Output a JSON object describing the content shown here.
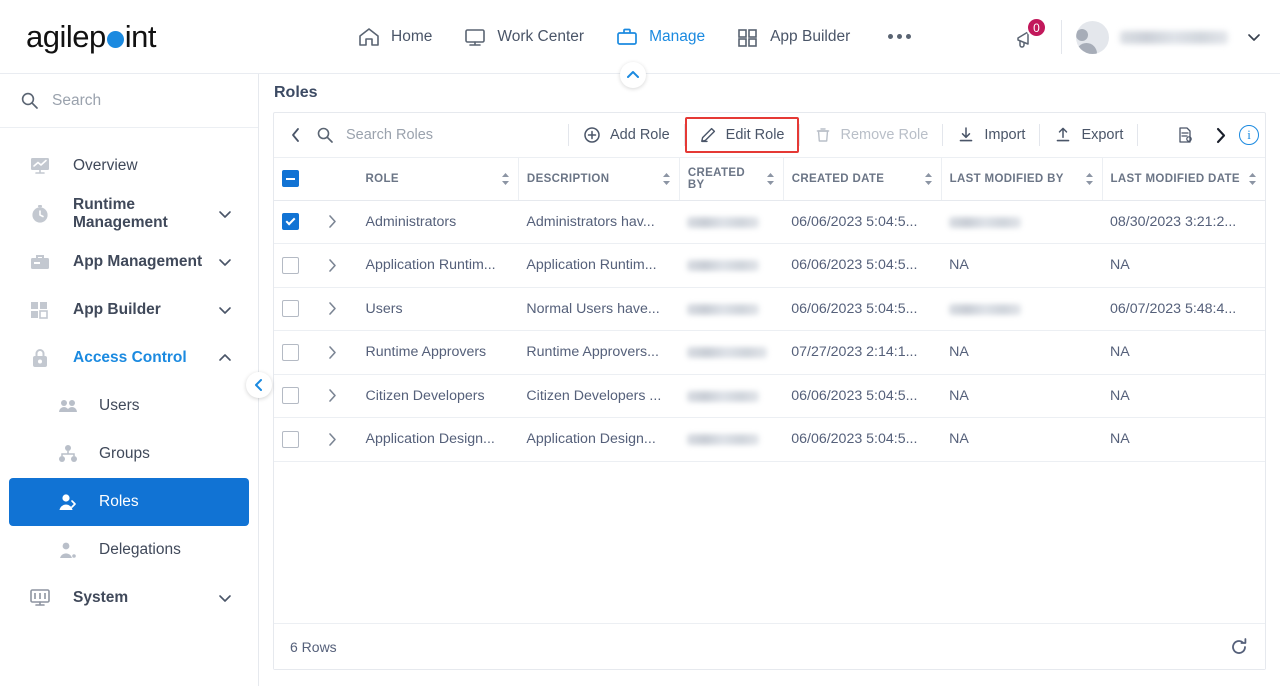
{
  "brand": {
    "name_part1": "agilep",
    "name_part2": "int",
    "dot_color": "#1b8ae0"
  },
  "topnav": {
    "items": [
      {
        "label": "Home",
        "icon": "home-icon",
        "active": false
      },
      {
        "label": "Work Center",
        "icon": "monitor-icon",
        "active": false
      },
      {
        "label": "Manage",
        "icon": "briefcase-icon",
        "active": true
      },
      {
        "label": "App Builder",
        "icon": "grid-icon",
        "active": false
      }
    ],
    "overflow_icon": "ellipsis-icon",
    "notification": {
      "icon": "megaphone-icon",
      "count": "0",
      "badge_color": "#c2185b"
    },
    "user": {
      "avatar_icon": "avatar-icon",
      "name": "",
      "caret_icon": "chevron-down-icon"
    }
  },
  "sidebar": {
    "search_placeholder": "Search",
    "search_icon": "search-icon",
    "items": [
      {
        "label": "Overview",
        "icon": "overview-icon",
        "expandable": false,
        "style": "normal"
      },
      {
        "label": "Runtime Management",
        "icon": "clock-icon",
        "expandable": true,
        "style": "bold"
      },
      {
        "label": "App Management",
        "icon": "toolbox-icon",
        "expandable": true,
        "style": "bold"
      },
      {
        "label": "App Builder",
        "icon": "builder-grid-icon",
        "expandable": true,
        "style": "bold"
      },
      {
        "label": "Access Control",
        "icon": "lock-icon",
        "expandable": true,
        "style": "accent",
        "expanded": true
      },
      {
        "label": "Users",
        "icon": "users-icon",
        "sub": true,
        "style": "normal"
      },
      {
        "label": "Groups",
        "icon": "groups-icon",
        "sub": true,
        "style": "normal"
      },
      {
        "label": "Roles",
        "icon": "role-icon",
        "sub": true,
        "style": "normal",
        "selected": true
      },
      {
        "label": "Delegations",
        "icon": "delegation-icon",
        "sub": true,
        "style": "normal"
      },
      {
        "label": "System",
        "icon": "system-icon",
        "expandable": true,
        "style": "bold"
      }
    ],
    "collapse_icon": "chevron-left-icon",
    "selected_color": "#1173d4"
  },
  "page": {
    "title": "Roles",
    "collapse_top_icon": "chevron-up-icon"
  },
  "toolbar": {
    "back_icon": "chevron-left-icon",
    "search_icon": "search-icon",
    "search_placeholder": "Search Roles",
    "buttons": [
      {
        "label": "Add Role",
        "icon": "plus-circle-icon",
        "disabled": false,
        "highlighted": false
      },
      {
        "label": "Edit Role",
        "icon": "pencil-icon",
        "disabled": false,
        "highlighted": true
      },
      {
        "label": "Remove Role",
        "icon": "trash-icon",
        "disabled": true,
        "highlighted": false
      },
      {
        "label": "Import",
        "icon": "import-icon",
        "disabled": false,
        "highlighted": false
      },
      {
        "label": "Export",
        "icon": "export-icon",
        "disabled": false,
        "highlighted": false
      }
    ],
    "report_icon": "report-icon",
    "more_icon": "chevron-right-icon",
    "info_icon": "info-icon",
    "highlight_color": "#e53935"
  },
  "table": {
    "select_all_state": "indeterminate",
    "columns": [
      {
        "label": "ROLE",
        "sortable": true
      },
      {
        "label": "DESCRIPTION",
        "sortable": true
      },
      {
        "label": "CREATED BY",
        "sortable": true
      },
      {
        "label": "CREATED DATE",
        "sortable": true
      },
      {
        "label": "LAST MODIFIED BY",
        "sortable": true
      },
      {
        "label": "LAST MODIFIED DATE",
        "sortable": true
      }
    ],
    "rows": [
      {
        "selected": true,
        "role": "Administrators",
        "description": "Administrators hav...",
        "created_by": "",
        "created_by_masked": true,
        "created_date": "06/06/2023 5:04:5...",
        "last_modified_by": "",
        "last_modified_by_masked": true,
        "last_modified_date": "08/30/2023 3:21:2..."
      },
      {
        "selected": false,
        "role": "Application Runtim...",
        "description": "Application Runtim...",
        "created_by": "",
        "created_by_masked": true,
        "created_date": "06/06/2023 5:04:5...",
        "last_modified_by": "NA",
        "last_modified_by_masked": false,
        "last_modified_date": "NA"
      },
      {
        "selected": false,
        "role": "Users",
        "description": "Normal Users have...",
        "created_by": "",
        "created_by_masked": true,
        "created_date": "06/06/2023 5:04:5...",
        "last_modified_by": "",
        "last_modified_by_masked": true,
        "last_modified_date": "06/07/2023 5:48:4..."
      },
      {
        "selected": false,
        "role": "Runtime Approvers",
        "description": "Runtime Approvers...",
        "created_by": "",
        "created_by_masked": true,
        "created_date": "07/27/2023 2:14:1...",
        "last_modified_by": "NA",
        "last_modified_by_masked": false,
        "last_modified_date": "NA"
      },
      {
        "selected": false,
        "role": "Citizen Developers",
        "description": "Citizen Developers ...",
        "created_by": "",
        "created_by_masked": true,
        "created_date": "06/06/2023 5:04:5...",
        "last_modified_by": "NA",
        "last_modified_by_masked": false,
        "last_modified_date": "NA"
      },
      {
        "selected": false,
        "role": "Application Design...",
        "description": "Application Design...",
        "created_by": "",
        "created_by_masked": true,
        "created_date": "06/06/2023 5:04:5...",
        "last_modified_by": "NA",
        "last_modified_by_masked": false,
        "last_modified_date": "NA"
      }
    ],
    "expand_icon": "chevron-right-icon"
  },
  "footer": {
    "rows_label": "6 Rows",
    "refresh_icon": "refresh-icon"
  }
}
